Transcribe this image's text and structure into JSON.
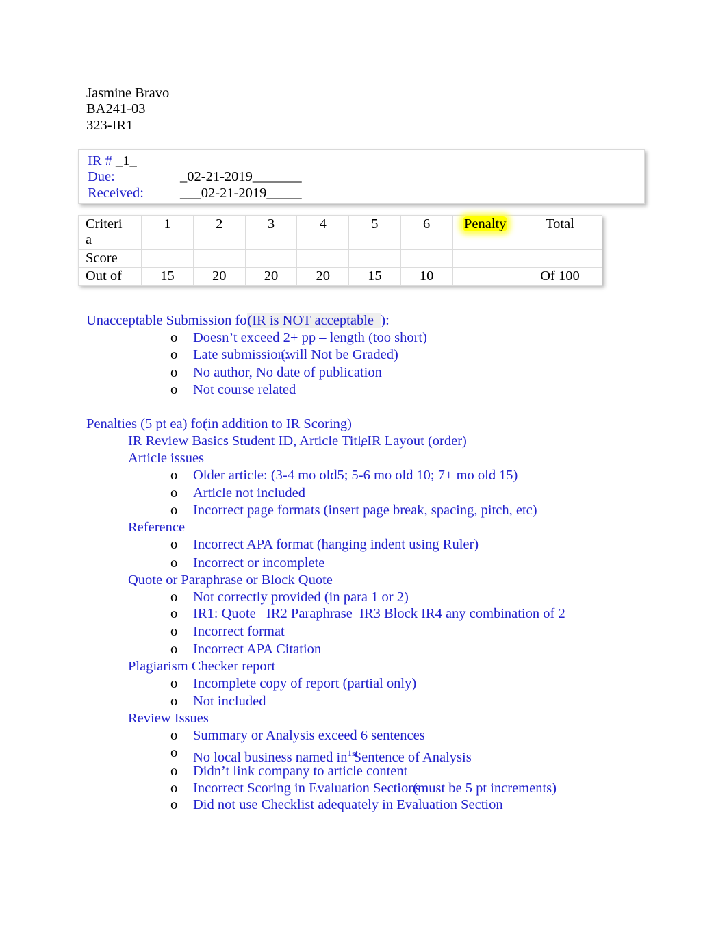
{
  "header": {
    "student_name": "Jasmine Bravo",
    "course": "BA241-03",
    "assignment": "323-IR1"
  },
  "ir_box": {
    "ir_number_label": "IR # ",
    "ir_number_value": "_1_",
    "due_label": "Due:",
    "due_value": "_02-21-2019_______",
    "received_label": "Received:",
    "received_value": "___02-21-2019_____"
  },
  "score_table": {
    "criteria_label": "Criteri\na",
    "criteria_line1": "Criteri",
    "criteria_line2": "a",
    "score_label": "Score",
    "out_of_label": "Out of",
    "columns": [
      "1",
      "2",
      "3",
      "4",
      "5",
      "6"
    ],
    "penalty_label": "Penalty",
    "penalty_highlight_color": "#ffff00",
    "total_label": "Total",
    "out_of_values": [
      "15",
      "20",
      "20",
      "20",
      "15",
      "10"
    ],
    "total_value": "Of 100",
    "score_values": [
      "",
      "",
      "",
      "",
      "",
      ""
    ]
  },
  "unacceptable": {
    "heading_main": "Unacceptable Submission for",
    "heading_paren": "(IR is",
    "heading_not": " NOT acceptable  ",
    "heading_close": "):",
    "items": [
      "Doesn’t exceed 2+ pp – length (too short)",
      "Late submission:",
      "No author, No date of publication",
      "Not course related"
    ],
    "late_tail": "(will Not be Graded)"
  },
  "penalties": {
    "heading_main": "Penalties (5 pt ea) for",
    "heading_tail": "(in addition to IR Scoring)",
    "groups": [
      {
        "label": "IR Review Basics",
        "inline_tail_a": ": Student ID, Article Title",
        "inline_tail_b": ", IR Layout (order)",
        "items": []
      },
      {
        "label": "Article issues",
        "items": [
          {
            "prefix": "Older article: (3-4 mo old",
            "v1": ": 5",
            "mid": "; 5-6 mo old",
            "v2": ": 10",
            "mid2": "; 7+ mo old",
            "v3": ": 15",
            "suffix": ")"
          },
          {
            "text": "Article not included"
          },
          {
            "text": "Incorrect page formats (insert page break, spacing, pitch, etc)"
          }
        ]
      },
      {
        "label": "Reference",
        "items": [
          {
            "text": "Incorrect APA format (hanging indent using Ruler)"
          },
          {
            "text": "Incorrect or incomplete"
          }
        ]
      },
      {
        "label": "Quote or Paraphrase or Block Quote",
        "items": [
          {
            "text": "Not correctly provided (in para 1 or 2)"
          },
          {
            "text": "IR1: Quote   IR2 Paraphrase  IR3 Block IR4 any combination of 2"
          },
          {
            "text": "Incorrect format"
          },
          {
            "text": "Incorrect APA Citation"
          }
        ]
      },
      {
        "label": "Plagiarism Checker report",
        "items": [
          {
            "text": "Incomplete copy of report (partial only)"
          },
          {
            "text": "Not included"
          }
        ]
      },
      {
        "label": "Review Issues",
        "items": [
          {
            "text": "Summary or Analysis exceed 6 sentences"
          },
          {
            "prefix": "No local business named in",
            "sup": "1st",
            "suffix": " Sentence of Analysis"
          },
          {
            "text": "Didn’t link company to article content"
          },
          {
            "prefix": "Incorrect Scoring in Evaluation Sections",
            "tail": "(must be 5 pt increments)"
          },
          {
            "text": "Did not use Checklist adequately in Evaluation Section"
          }
        ]
      }
    ]
  },
  "colors": {
    "body_blue": "#2222cc",
    "highlight_yellow": "#ffff00",
    "table_border": "#dcdcdc"
  }
}
